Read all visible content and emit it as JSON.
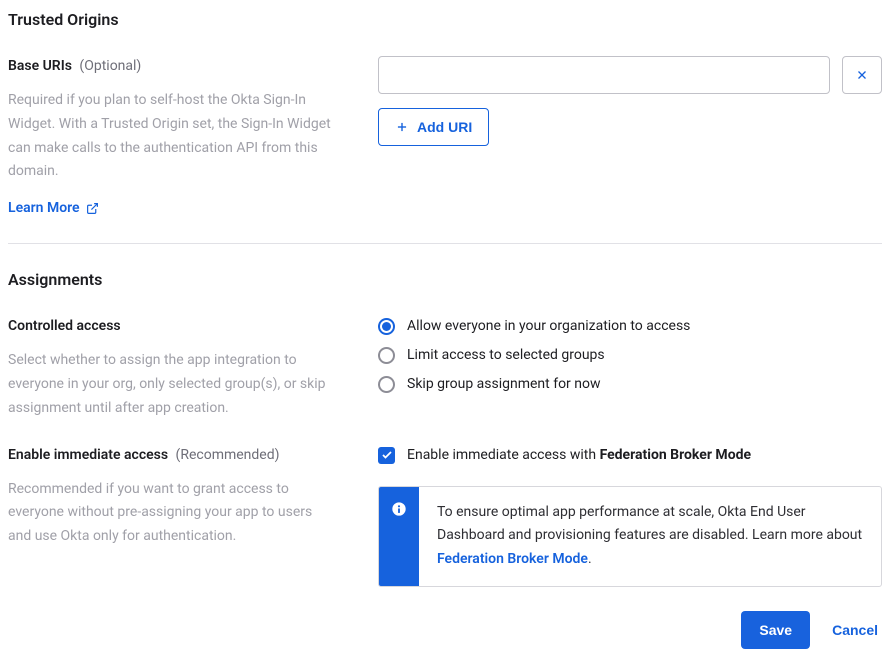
{
  "trusted_origins": {
    "title": "Trusted Origins",
    "base_uris": {
      "label": "Base URIs",
      "optional": "(Optional)",
      "desc": "Required if you plan to self-host the Okta Sign-In Widget. With a Trusted Origin set, the Sign-In Widget can make calls to the authentication API from this domain.",
      "learn_more": "Learn More",
      "add_uri": "Add URI",
      "uri_value": ""
    }
  },
  "assignments": {
    "title": "Assignments",
    "controlled_access": {
      "label": "Controlled access",
      "desc": "Select whether to assign the app integration to everyone in your org, only selected group(s), or skip assignment until after app creation.",
      "options": [
        "Allow everyone in your organization to access",
        "Limit access to selected groups",
        "Skip group assignment for now"
      ],
      "selected": 0
    },
    "immediate_access": {
      "label": "Enable immediate access",
      "recommended": "(Recommended)",
      "desc": "Recommended if you want to grant access to everyone without pre-assigning your app to users and use Okta only for authentication.",
      "checkbox_prefix": "Enable immediate access with ",
      "checkbox_suffix": "Federation Broker Mode",
      "checked": true,
      "info_prefix": "To ensure optimal app performance at scale, Okta End User Dashboard and provisioning features are disabled. Learn more about ",
      "info_link": "Federation Broker Mode",
      "info_suffix": "."
    }
  },
  "footer": {
    "save": "Save",
    "cancel": "Cancel"
  }
}
